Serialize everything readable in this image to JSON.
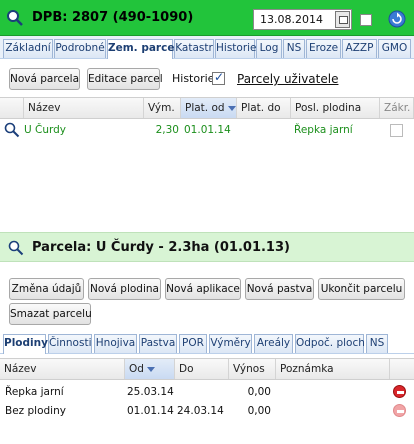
{
  "header": {
    "title": "DPB: 2807 (490-1090)",
    "date_value": "13.08.2014",
    "accent_color": "#22c43b"
  },
  "main_tabs": [
    {
      "label": "Základní"
    },
    {
      "label": "Podrobné"
    },
    {
      "label": "Zem. parcely"
    },
    {
      "label": "Katastr"
    },
    {
      "label": "Historie"
    },
    {
      "label": "Log"
    },
    {
      "label": "NS"
    },
    {
      "label": "Eroze"
    },
    {
      "label": "AZZP"
    },
    {
      "label": "GMO"
    }
  ],
  "toolbar": {
    "new_parcel": "Nová parcela",
    "edit_parcel": "Editace parcel",
    "history_label": "Historie",
    "history_checked": true,
    "user_parcels_link": "Parcely uživatele"
  },
  "parcels_table": {
    "columns": [
      "Název",
      "Vým.",
      "Plat. od",
      "Plat. do",
      "Posl. plodina",
      "Zákr."
    ],
    "rows": [
      {
        "name": "U Čurdy",
        "area": "2,30",
        "valid_from": "01.01.14",
        "valid_to": "",
        "last_crop": "Řepka jarní"
      }
    ]
  },
  "detail": {
    "title": "Parcela: U Čurdy - 2.3ha (01.01.13)",
    "buttons": {
      "change_data": "Změna údajů",
      "new_crop": "Nová plodina",
      "new_application": "Nová aplikace",
      "new_pasture": "Nová pastva",
      "end_parcel": "Ukončit parcelu",
      "delete_parcel": "Smazat parcelu"
    },
    "tabs": [
      {
        "label": "Plodiny"
      },
      {
        "label": "Činnosti"
      },
      {
        "label": "Hnojiva"
      },
      {
        "label": "Pastva"
      },
      {
        "label": "POR"
      },
      {
        "label": "Výměry"
      },
      {
        "label": "Areály"
      },
      {
        "label": "Odpoč. ploch"
      },
      {
        "label": "NS"
      }
    ]
  },
  "crops_table": {
    "columns": [
      "Název",
      "Od",
      "Do",
      "Výnos",
      "Poznámka"
    ],
    "rows": [
      {
        "name": "Řepka jarní",
        "from": "25.03.14",
        "to": "",
        "yield": "0,00",
        "note": ""
      },
      {
        "name": "Bez plodiny",
        "from": "01.01.14",
        "to": "24.03.14",
        "yield": "0,00",
        "note": ""
      }
    ]
  }
}
